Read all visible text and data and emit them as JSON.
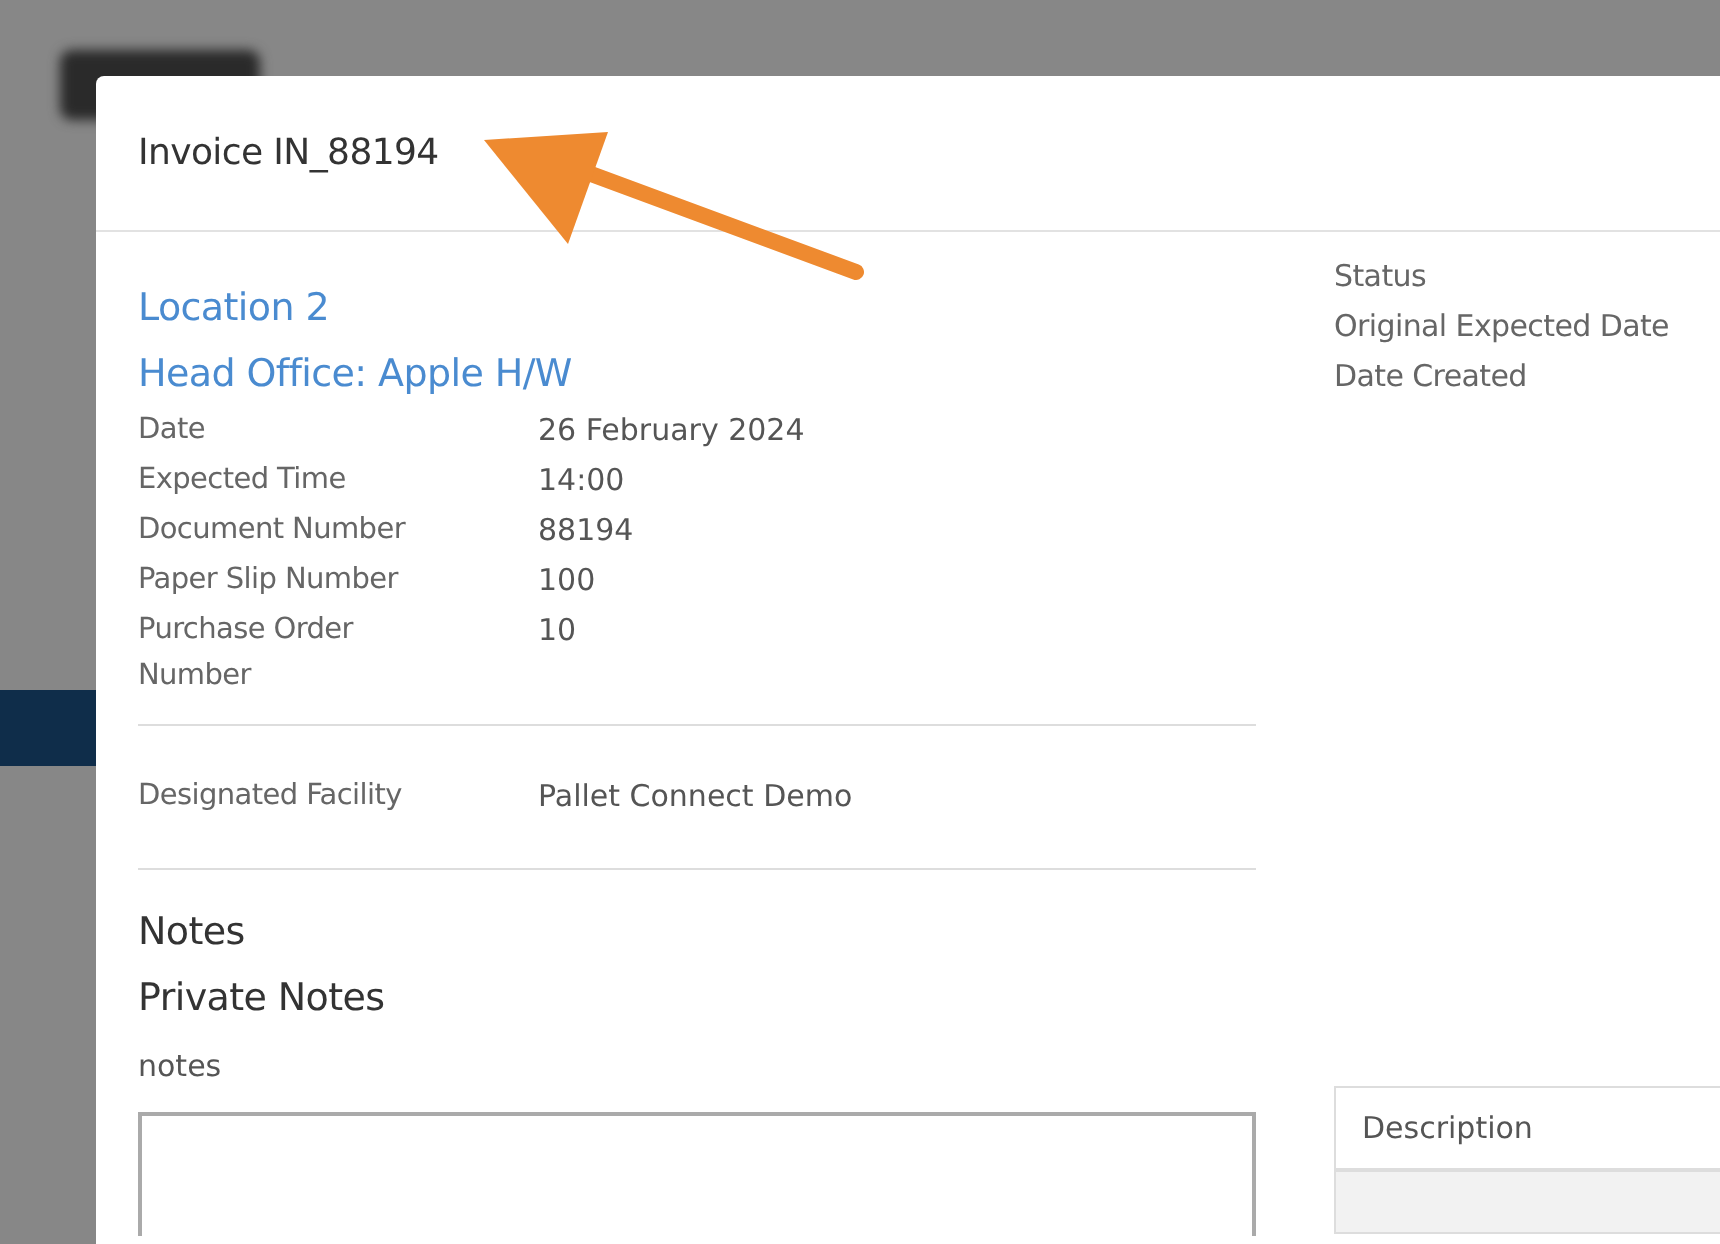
{
  "dialog": {
    "title": "Invoice IN_88194"
  },
  "location": {
    "name": "Location 2",
    "head_office": "Head Office: Apple H/W"
  },
  "details": [
    {
      "label": "Date",
      "value": "26 February 2024"
    },
    {
      "label": "Expected Time",
      "value": "14:00"
    },
    {
      "label": "Document Number",
      "value": "88194"
    },
    {
      "label": "Paper Slip Number",
      "value": "100"
    },
    {
      "label": "Purchase Order Number",
      "value": "10"
    }
  ],
  "facility": {
    "label": "Designated Facility",
    "value": "Pallet Connect Demo"
  },
  "notes": {
    "heading": "Notes",
    "private_heading": "Private Notes",
    "field_label": "notes"
  },
  "status_labels": [
    "Status",
    "Original Expected Date",
    "Date Created"
  ],
  "table": {
    "columns": [
      "Description"
    ]
  }
}
